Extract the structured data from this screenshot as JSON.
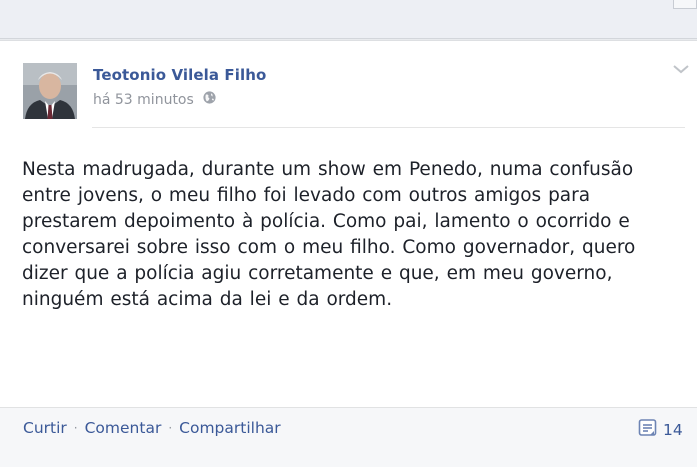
{
  "post": {
    "author": "Teotonio Vilela Filho",
    "timestamp": "há 53 minutos",
    "privacy_icon": "globe-icon",
    "menu_icon": "chevron-down-icon",
    "text": "Nesta madrugada, durante um show em Penedo, numa confusão entre jovens, o meu filho foi levado com outros amigos para prestarem depoimento à polícia. Como pai, lamento o ocorrido e conversarei sobre isso com o meu filho. Como governador, quero dizer que a polícia agiu corretamente e que, em meu governo, ninguém está acima da lei e da ordem."
  },
  "actions": {
    "like": "Curtir",
    "comment": "Comentar",
    "share": "Compartilhar",
    "separator": "·",
    "comment_count": "14",
    "comment_icon": "comment-count-icon"
  },
  "colors": {
    "link": "#3b5998",
    "meta": "#90949c",
    "text": "#1d2129",
    "footer_bg": "#f6f7f9"
  }
}
